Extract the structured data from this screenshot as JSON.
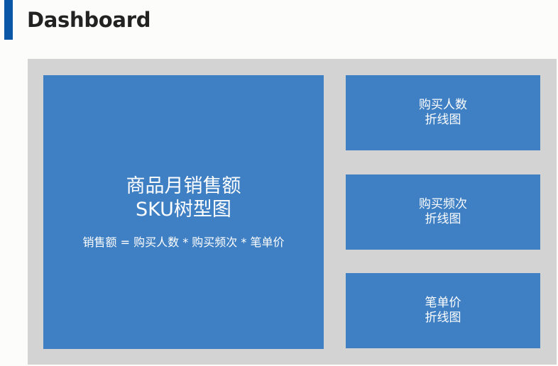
{
  "header": {
    "title": "Dashboard"
  },
  "colors": {
    "accent": "#0a56a7",
    "canvas_background": "#d3d3d3",
    "tile_fill": "#3f7fc3",
    "tile_text": "#ffffff",
    "title_text": "#222222"
  },
  "main_tile": {
    "line1": "商品月销售额",
    "line2": "SKU树型图",
    "formula": "销售额 = 购买人数 * 购买频次 * 笔单价"
  },
  "side_tiles": [
    {
      "line1": "购买人数",
      "line2": "折线图"
    },
    {
      "line1": "购买频次",
      "line2": "折线图"
    },
    {
      "line1": "笔单价",
      "line2": "折线图"
    }
  ]
}
